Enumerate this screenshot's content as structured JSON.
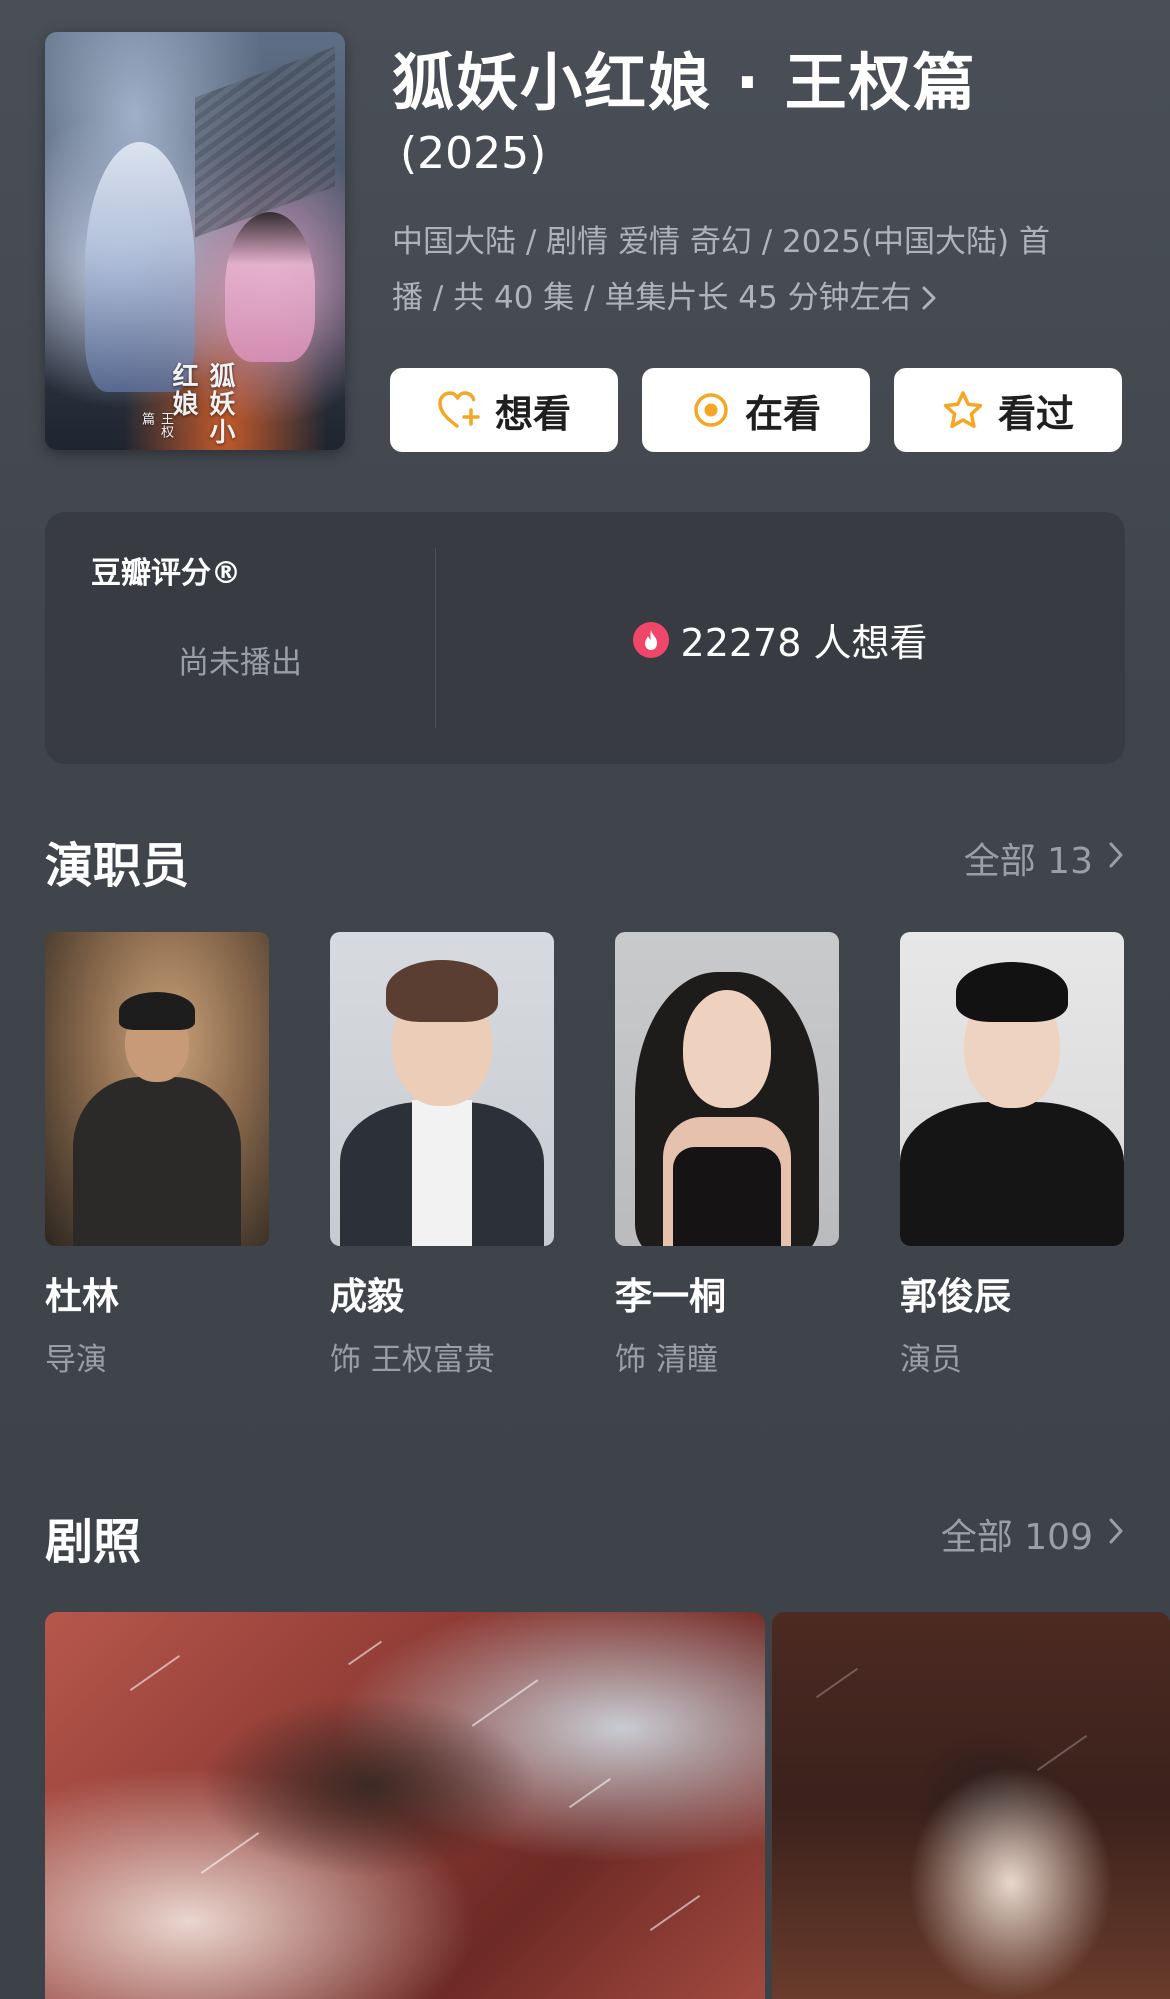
{
  "header": {
    "title": "狐妖小红娘 · 王权篇",
    "year": "(2025)",
    "meta_line1": "中国大陆 / 剧情 爱情 奇幻 / 2025(中国大陆) 首",
    "meta_line2": "播 / 共 40 集 / 单集片长 45 分钟左右",
    "poster_title": "狐妖小红娘",
    "poster_subtitle": "王权篇"
  },
  "actions": [
    {
      "label": "想看",
      "icon": "heart-plus-icon"
    },
    {
      "label": "在看",
      "icon": "target-icon"
    },
    {
      "label": "看过",
      "icon": "star-icon"
    }
  ],
  "rating": {
    "label": "豆瓣评分®",
    "status": "尚未播出",
    "wish_count": "22278 人想看"
  },
  "cast_section": {
    "title": "演职员",
    "more": "全部 13"
  },
  "cast": [
    {
      "name": "杜林",
      "role": "导演"
    },
    {
      "name": "成毅",
      "role": "饰 王权富贵"
    },
    {
      "name": "李一桐",
      "role": "饰 清瞳"
    },
    {
      "name": "郭俊辰",
      "role": "演员"
    }
  ],
  "stills_section": {
    "title": "剧照",
    "more": "全部 109"
  },
  "colors": {
    "background": "#3e434a",
    "card": "#383c42",
    "accent_orange": "#f5a623",
    "fire_red": "#f0466a",
    "muted_text": "#9a9ea5"
  }
}
